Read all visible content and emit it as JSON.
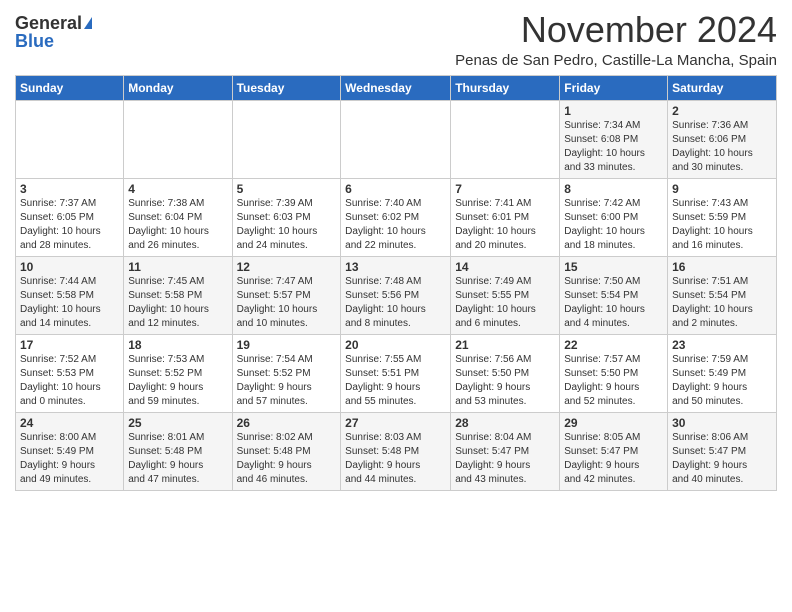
{
  "header": {
    "logo_general": "General",
    "logo_blue": "Blue",
    "month_title": "November 2024",
    "subtitle": "Penas de San Pedro, Castille-La Mancha, Spain"
  },
  "calendar": {
    "headers": [
      "Sunday",
      "Monday",
      "Tuesday",
      "Wednesday",
      "Thursday",
      "Friday",
      "Saturday"
    ],
    "weeks": [
      [
        {
          "day": "",
          "info": ""
        },
        {
          "day": "",
          "info": ""
        },
        {
          "day": "",
          "info": ""
        },
        {
          "day": "",
          "info": ""
        },
        {
          "day": "",
          "info": ""
        },
        {
          "day": "1",
          "info": "Sunrise: 7:34 AM\nSunset: 6:08 PM\nDaylight: 10 hours\nand 33 minutes."
        },
        {
          "day": "2",
          "info": "Sunrise: 7:36 AM\nSunset: 6:06 PM\nDaylight: 10 hours\nand 30 minutes."
        }
      ],
      [
        {
          "day": "3",
          "info": "Sunrise: 7:37 AM\nSunset: 6:05 PM\nDaylight: 10 hours\nand 28 minutes."
        },
        {
          "day": "4",
          "info": "Sunrise: 7:38 AM\nSunset: 6:04 PM\nDaylight: 10 hours\nand 26 minutes."
        },
        {
          "day": "5",
          "info": "Sunrise: 7:39 AM\nSunset: 6:03 PM\nDaylight: 10 hours\nand 24 minutes."
        },
        {
          "day": "6",
          "info": "Sunrise: 7:40 AM\nSunset: 6:02 PM\nDaylight: 10 hours\nand 22 minutes."
        },
        {
          "day": "7",
          "info": "Sunrise: 7:41 AM\nSunset: 6:01 PM\nDaylight: 10 hours\nand 20 minutes."
        },
        {
          "day": "8",
          "info": "Sunrise: 7:42 AM\nSunset: 6:00 PM\nDaylight: 10 hours\nand 18 minutes."
        },
        {
          "day": "9",
          "info": "Sunrise: 7:43 AM\nSunset: 5:59 PM\nDaylight: 10 hours\nand 16 minutes."
        }
      ],
      [
        {
          "day": "10",
          "info": "Sunrise: 7:44 AM\nSunset: 5:58 PM\nDaylight: 10 hours\nand 14 minutes."
        },
        {
          "day": "11",
          "info": "Sunrise: 7:45 AM\nSunset: 5:58 PM\nDaylight: 10 hours\nand 12 minutes."
        },
        {
          "day": "12",
          "info": "Sunrise: 7:47 AM\nSunset: 5:57 PM\nDaylight: 10 hours\nand 10 minutes."
        },
        {
          "day": "13",
          "info": "Sunrise: 7:48 AM\nSunset: 5:56 PM\nDaylight: 10 hours\nand 8 minutes."
        },
        {
          "day": "14",
          "info": "Sunrise: 7:49 AM\nSunset: 5:55 PM\nDaylight: 10 hours\nand 6 minutes."
        },
        {
          "day": "15",
          "info": "Sunrise: 7:50 AM\nSunset: 5:54 PM\nDaylight: 10 hours\nand 4 minutes."
        },
        {
          "day": "16",
          "info": "Sunrise: 7:51 AM\nSunset: 5:54 PM\nDaylight: 10 hours\nand 2 minutes."
        }
      ],
      [
        {
          "day": "17",
          "info": "Sunrise: 7:52 AM\nSunset: 5:53 PM\nDaylight: 10 hours\nand 0 minutes."
        },
        {
          "day": "18",
          "info": "Sunrise: 7:53 AM\nSunset: 5:52 PM\nDaylight: 9 hours\nand 59 minutes."
        },
        {
          "day": "19",
          "info": "Sunrise: 7:54 AM\nSunset: 5:52 PM\nDaylight: 9 hours\nand 57 minutes."
        },
        {
          "day": "20",
          "info": "Sunrise: 7:55 AM\nSunset: 5:51 PM\nDaylight: 9 hours\nand 55 minutes."
        },
        {
          "day": "21",
          "info": "Sunrise: 7:56 AM\nSunset: 5:50 PM\nDaylight: 9 hours\nand 53 minutes."
        },
        {
          "day": "22",
          "info": "Sunrise: 7:57 AM\nSunset: 5:50 PM\nDaylight: 9 hours\nand 52 minutes."
        },
        {
          "day": "23",
          "info": "Sunrise: 7:59 AM\nSunset: 5:49 PM\nDaylight: 9 hours\nand 50 minutes."
        }
      ],
      [
        {
          "day": "24",
          "info": "Sunrise: 8:00 AM\nSunset: 5:49 PM\nDaylight: 9 hours\nand 49 minutes."
        },
        {
          "day": "25",
          "info": "Sunrise: 8:01 AM\nSunset: 5:48 PM\nDaylight: 9 hours\nand 47 minutes."
        },
        {
          "day": "26",
          "info": "Sunrise: 8:02 AM\nSunset: 5:48 PM\nDaylight: 9 hours\nand 46 minutes."
        },
        {
          "day": "27",
          "info": "Sunrise: 8:03 AM\nSunset: 5:48 PM\nDaylight: 9 hours\nand 44 minutes."
        },
        {
          "day": "28",
          "info": "Sunrise: 8:04 AM\nSunset: 5:47 PM\nDaylight: 9 hours\nand 43 minutes."
        },
        {
          "day": "29",
          "info": "Sunrise: 8:05 AM\nSunset: 5:47 PM\nDaylight: 9 hours\nand 42 minutes."
        },
        {
          "day": "30",
          "info": "Sunrise: 8:06 AM\nSunset: 5:47 PM\nDaylight: 9 hours\nand 40 minutes."
        }
      ]
    ]
  }
}
